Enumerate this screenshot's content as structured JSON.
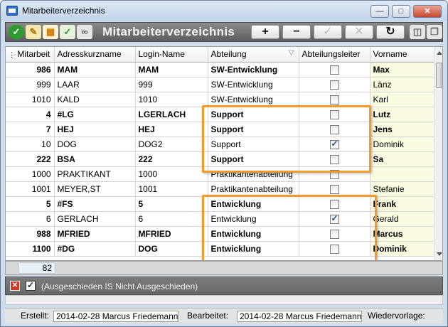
{
  "window": {
    "title": "Mitarbeiterverzeichnis"
  },
  "toolbar": {
    "title": "Mitarbeiterverzeichnis",
    "add_label": "+",
    "remove_label": "−",
    "confirm_label": "✓",
    "cancel_label": "✕",
    "refresh_label": "↻"
  },
  "table": {
    "columns": [
      "Mitarbeit",
      "Adresskurzname",
      "Login-Name",
      "Abteilung",
      "Abteilungsleiter",
      "Vorname"
    ],
    "sort_indicator": "▽",
    "rows": [
      {
        "nr": "986",
        "kurz": "MAM",
        "login": "MAM",
        "abt": "SW-Entwicklung",
        "leiter": false,
        "vorname": "Max",
        "bold": true
      },
      {
        "nr": "999",
        "kurz": "LAAR",
        "login": "999",
        "abt": "SW-Entwicklung",
        "leiter": false,
        "vorname": "Länz",
        "bold": false
      },
      {
        "nr": "1010",
        "kurz": "KALD",
        "login": "1010",
        "abt": "SW-Entwicklung",
        "leiter": false,
        "vorname": "Karl",
        "bold": false
      },
      {
        "nr": "4",
        "kurz": "#LG",
        "login": "LGERLACH",
        "abt": "Support",
        "leiter": false,
        "vorname": "Lutz",
        "bold": true
      },
      {
        "nr": "7",
        "kurz": "HEJ",
        "login": "HEJ",
        "abt": "Support",
        "leiter": false,
        "vorname": "Jens",
        "bold": true
      },
      {
        "nr": "10",
        "kurz": "DOG",
        "login": "DOG2",
        "abt": "Support",
        "leiter": true,
        "vorname": "Dominik",
        "bold": false
      },
      {
        "nr": "222",
        "kurz": "BSA",
        "login": "222",
        "abt": "Support",
        "leiter": false,
        "vorname": "Sa",
        "bold": true
      },
      {
        "nr": "1000",
        "kurz": "PRAKTIKANT",
        "login": "1000",
        "abt": "Praktikantenabteilung",
        "leiter": false,
        "vorname": "",
        "bold": false
      },
      {
        "nr": "1001",
        "kurz": "MEYER,ST",
        "login": "1001",
        "abt": "Praktikantenabteilung",
        "leiter": false,
        "vorname": "Stefanie",
        "bold": false
      },
      {
        "nr": "5",
        "kurz": "#FS",
        "login": "5",
        "abt": "Entwicklung",
        "leiter": false,
        "vorname": "Frank",
        "bold": true
      },
      {
        "nr": "6",
        "kurz": "GERLACH",
        "login": "6",
        "abt": "Entwicklung",
        "leiter": true,
        "vorname": "Gerald",
        "bold": false
      },
      {
        "nr": "988",
        "kurz": "MFRIED",
        "login": "MFRIED",
        "abt": "Entwicklung",
        "leiter": false,
        "vorname": "Marcus",
        "bold": true
      },
      {
        "nr": "1100",
        "kurz": "#DG",
        "login": "DOG",
        "abt": "Entwicklung",
        "leiter": false,
        "vorname": "Dominik",
        "bold": true
      }
    ]
  },
  "count": "82",
  "filter": {
    "text": "(Ausgeschieden IS Nicht Ausgeschieden)"
  },
  "status": {
    "created_label": "Erstellt:",
    "created_value": "2014-02-28  Marcus Friedemann",
    "edited_label": "Bearbeitet:",
    "edited_value": "2014-02-28  Marcus Friedemann",
    "resubmit_label": "Wiedervorlage:"
  },
  "colors": {
    "highlight": "#f39a2e",
    "toolbar_bg": "#6e6e6e",
    "vorname_bg": "#fbfbe1"
  }
}
